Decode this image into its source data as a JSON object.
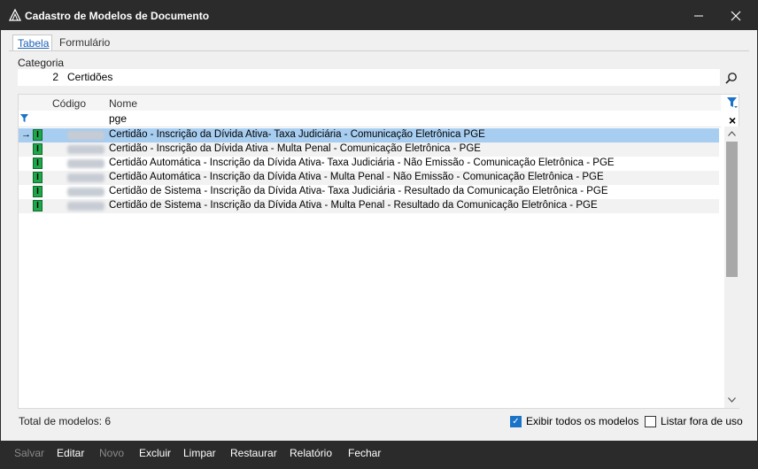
{
  "window": {
    "title": "Cadastro de Modelos de Documento"
  },
  "tabs": [
    {
      "label": "Tabela"
    },
    {
      "label": "Formulário"
    }
  ],
  "categoria": {
    "label": "Categoria",
    "code": "2",
    "name": "Certidões"
  },
  "grid": {
    "columns": {
      "code": "Código",
      "name": "Nome"
    },
    "filter_value": "pge",
    "rows": [
      {
        "name": "Certidão - Inscrição da Dívida Ativa- Taxa Judiciária - Comunicação Eletrônica PGE"
      },
      {
        "name": "Certidão - Inscrição da Dívida Ativa - Multa Penal - Comunicação Eletrônica - PGE"
      },
      {
        "name": "Certidão Automática - Inscrição da Dívida Ativa- Taxa Judiciária - Não Emissão - Comunicação Eletrônica - PGE"
      },
      {
        "name": "Certidão Automática - Inscrição da Dívida Ativa - Multa Penal - Não Emissão - Comunicação Eletrônica - PGE"
      },
      {
        "name": "Certidão de Sistema - Inscrição da Dívida Ativa- Taxa Judiciária - Resultado da Comunicação Eletrônica - PGE"
      },
      {
        "name": "Certidão de Sistema - Inscrição da Dívida Ativa - Multa Penal - Resultado da Comunicação Eletrônica - PGE"
      }
    ],
    "selected_row": 0,
    "badge_letter": "I"
  },
  "footer": {
    "total_label": "Total de modelos: 6",
    "show_all_label": "Exibir todos os modelos",
    "show_all_checked": true,
    "unused_label": "Listar fora de uso",
    "unused_checked": false
  },
  "toolbar": {
    "salvar": "Salvar",
    "editar": "Editar",
    "novo": "Novo",
    "excluir": "Excluir",
    "limpar": "Limpar",
    "restaurar": "Restaurar",
    "relatorio": "Relatório",
    "fechar": "Fechar"
  },
  "colors": {
    "selection": "#a7cdf0",
    "badge": "#1fa64a",
    "accent": "#1a73c9",
    "titlebar": "#2b2b2b"
  }
}
